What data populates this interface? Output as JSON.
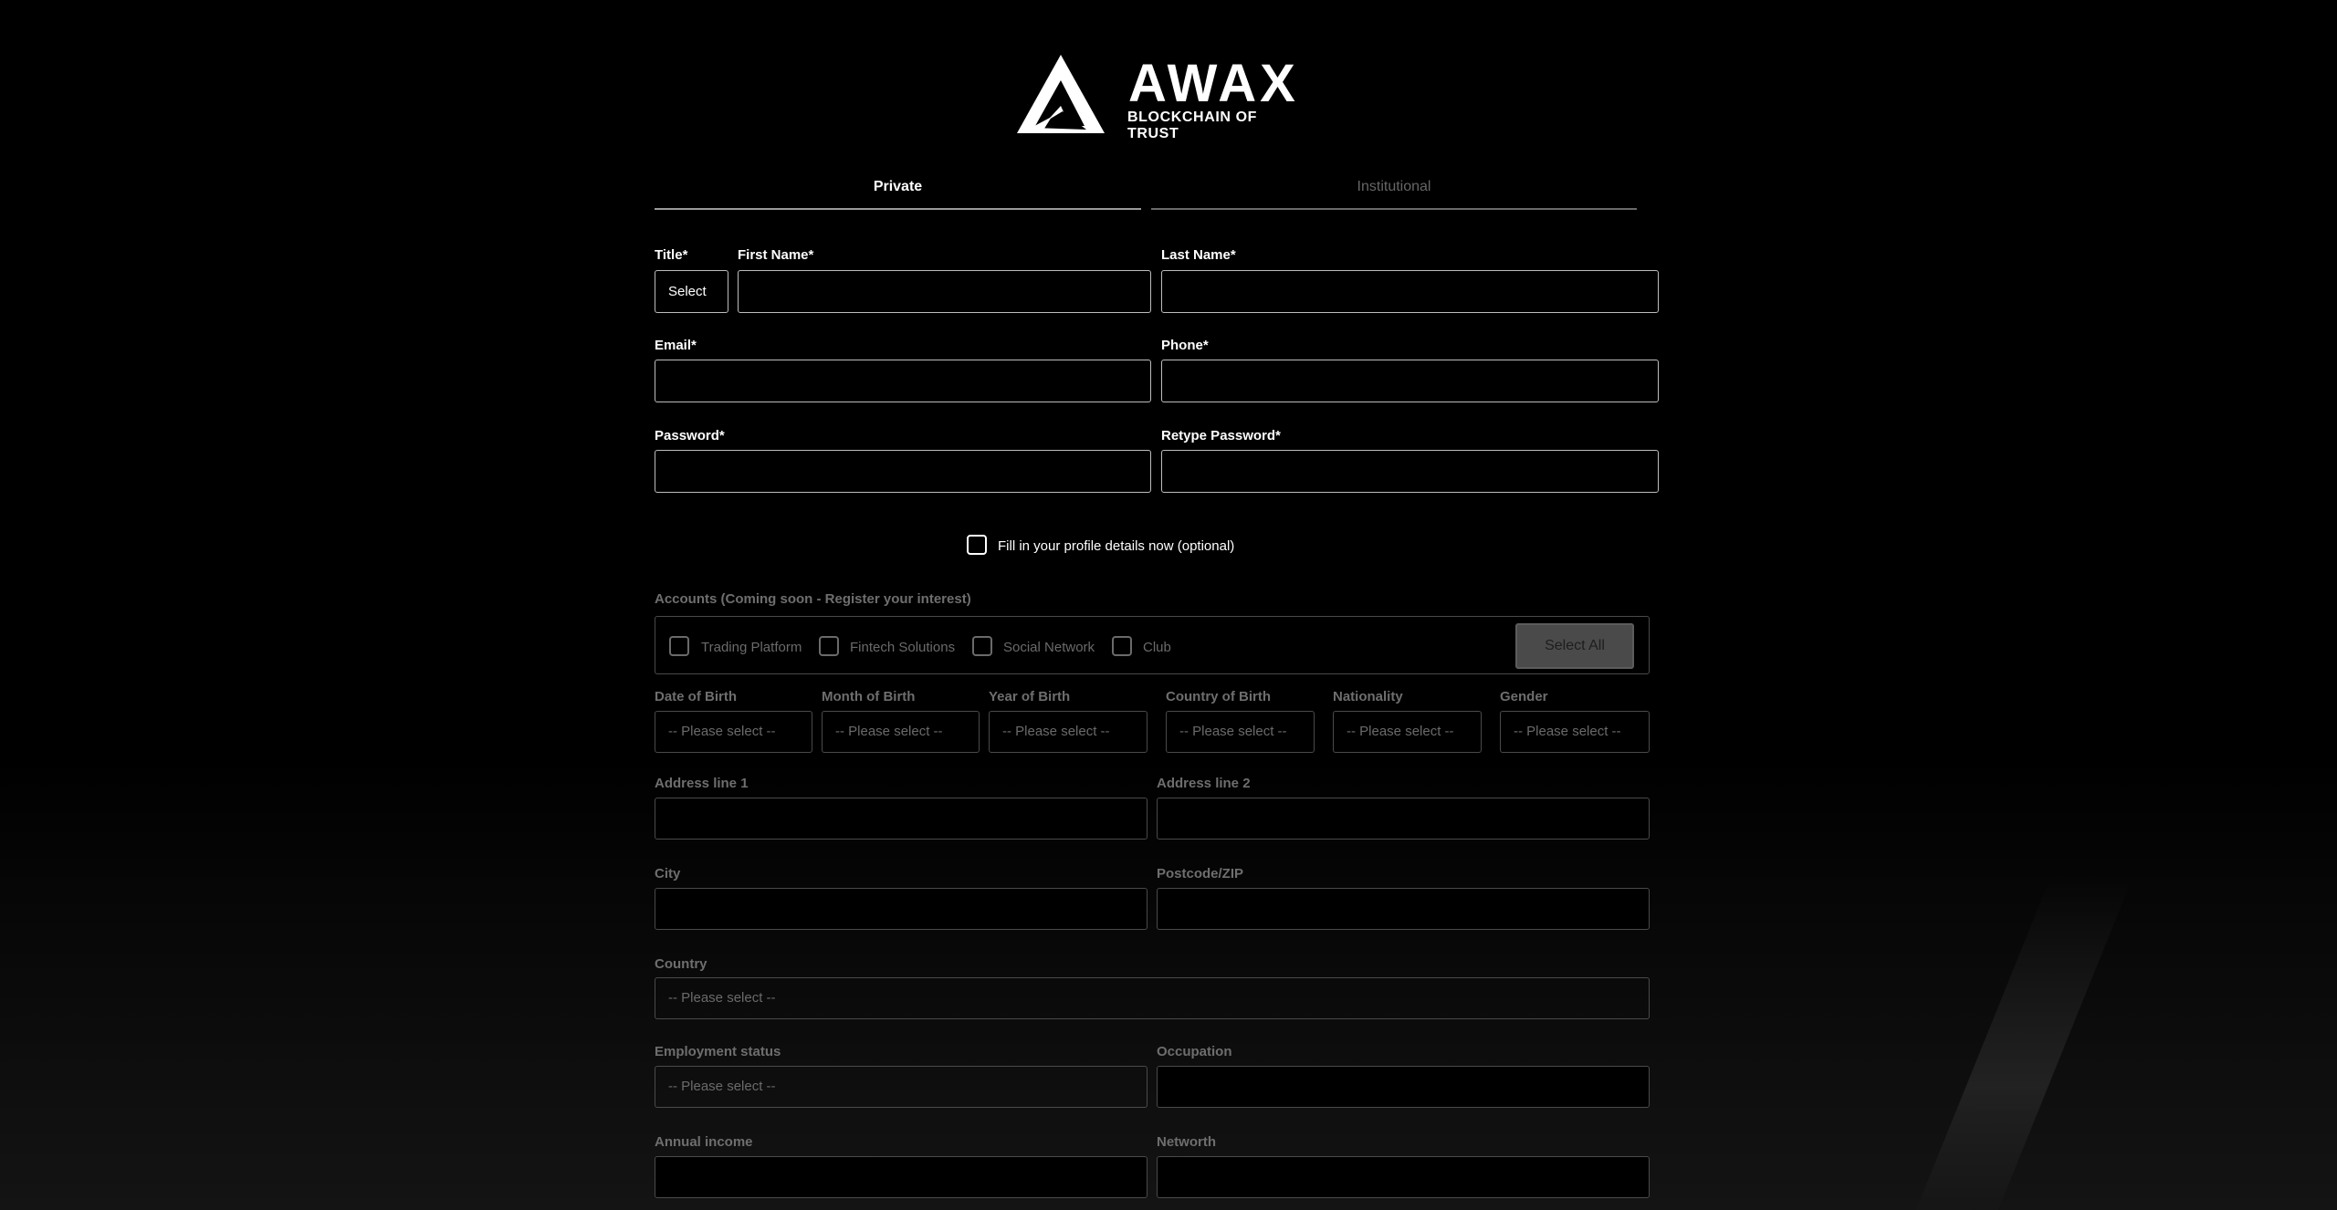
{
  "brand": {
    "name": "AWAX",
    "tagline": "BLOCKCHAIN OF TRUST"
  },
  "tabs": [
    {
      "label": "Private",
      "active": true
    },
    {
      "label": "Institutional",
      "active": false
    }
  ],
  "form": {
    "title_label": "Title*",
    "title_value": "Select",
    "first_name_label": "First Name*",
    "last_name_label": "Last Name*",
    "email_label": "Email*",
    "phone_label": "Phone*",
    "password_label": "Password*",
    "retype_password_label": "Retype Password*",
    "profile_optin_label": "Fill in your profile details now (optional)"
  },
  "profile": {
    "accounts_label": "Accounts (Coming soon - Register your interest)",
    "accounts": [
      "Trading Platform",
      "Fintech Solutions",
      "Social Network",
      "Club"
    ],
    "select_all_label": "Select All",
    "dob_day_label": "Date of Birth",
    "dob_month_label": "Month of Birth",
    "dob_year_label": "Year of Birth",
    "country_of_birth_label": "Country of Birth",
    "nationality_label": "Nationality",
    "gender_label": "Gender",
    "please_select": "-- Please select --",
    "address1_label": "Address line 1",
    "address2_label": "Address line 2",
    "city_label": "City",
    "postcode_label": "Postcode/ZIP",
    "country_label": "Country",
    "employment_label": "Employment status",
    "occupation_label": "Occupation",
    "annual_income_label": "Annual income",
    "networth_label": "Networth"
  },
  "colors": {
    "background": "#000000",
    "text": "#ffffff",
    "disabled_text": "#6e6e6e",
    "active_border": "#bdbdbd",
    "disabled_border": "#4a4a4a"
  }
}
